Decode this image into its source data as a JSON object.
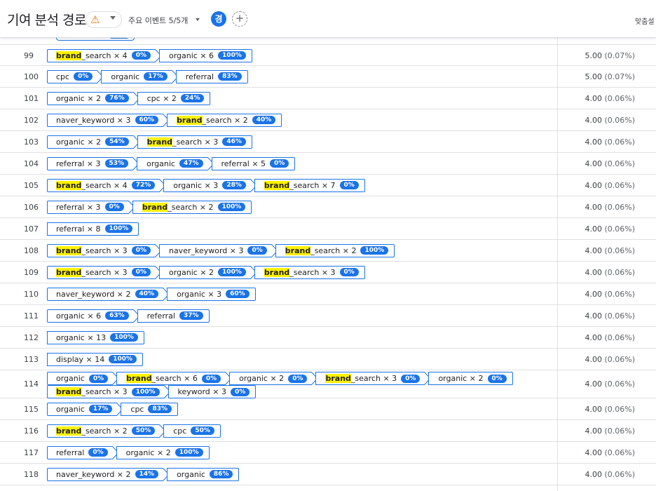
{
  "header": {
    "title": "기여 분석 경로",
    "events_label": "주요 이벤트 5/5개",
    "avatar_letter": "경",
    "add_label": "+",
    "right_text": "맞춤설"
  },
  "rows": [
    {
      "num": "99",
      "value": "5.00",
      "pct": "(0.07%)",
      "steps": [
        [
          {
            "t": "brand",
            "h": true
          },
          {
            "t": "_search × 4"
          }
        ],
        "0%"
      ],
      "path": [
        {
          "parts": [
            {
              "t": "brand",
              "h": true
            },
            {
              "t": "_search × 4"
            }
          ],
          "badge": "0%"
        },
        {
          "parts": [
            {
              "t": "organic × 6"
            }
          ],
          "badge": "100%"
        }
      ]
    },
    {
      "num": "100",
      "value": "5.00",
      "pct": "(0.07%)",
      "path": [
        {
          "parts": [
            {
              "t": "cpc"
            }
          ],
          "badge": "0%"
        },
        {
          "parts": [
            {
              "t": "organic"
            }
          ],
          "badge": "17%"
        },
        {
          "parts": [
            {
              "t": "referral"
            }
          ],
          "badge": "83%"
        }
      ]
    },
    {
      "num": "101",
      "value": "4.00",
      "pct": "(0.06%)",
      "path": [
        {
          "parts": [
            {
              "t": "organic × 2"
            }
          ],
          "badge": "76%"
        },
        {
          "parts": [
            {
              "t": "cpc × 2"
            }
          ],
          "badge": "24%"
        }
      ]
    },
    {
      "num": "102",
      "value": "4.00",
      "pct": "(0.06%)",
      "path": [
        {
          "parts": [
            {
              "t": "naver_keyword × 3"
            }
          ],
          "badge": "60%"
        },
        {
          "parts": [
            {
              "t": "brand",
              "h": true
            },
            {
              "t": "_search × 2"
            }
          ],
          "badge": "40%"
        }
      ]
    },
    {
      "num": "103",
      "value": "4.00",
      "pct": "(0.06%)",
      "path": [
        {
          "parts": [
            {
              "t": "organic × 2"
            }
          ],
          "badge": "54%"
        },
        {
          "parts": [
            {
              "t": "brand",
              "h": true
            },
            {
              "t": "_search × 3"
            }
          ],
          "badge": "46%"
        }
      ]
    },
    {
      "num": "104",
      "value": "4.00",
      "pct": "(0.06%)",
      "path": [
        {
          "parts": [
            {
              "t": "referral × 3"
            }
          ],
          "badge": "53%"
        },
        {
          "parts": [
            {
              "t": "organic"
            }
          ],
          "badge": "47%"
        },
        {
          "parts": [
            {
              "t": "referral × 5"
            }
          ],
          "badge": "0%"
        }
      ]
    },
    {
      "num": "105",
      "value": "4.00",
      "pct": "(0.06%)",
      "path": [
        {
          "parts": [
            {
              "t": "brand",
              "h": true
            },
            {
              "t": "_search × 4"
            }
          ],
          "badge": "72%"
        },
        {
          "parts": [
            {
              "t": "organic × 3"
            }
          ],
          "badge": "28%"
        },
        {
          "parts": [
            {
              "t": "brand",
              "h": true
            },
            {
              "t": "_search × 7"
            }
          ],
          "badge": "0%"
        }
      ]
    },
    {
      "num": "106",
      "value": "4.00",
      "pct": "(0.06%)",
      "path": [
        {
          "parts": [
            {
              "t": "referral × 3"
            }
          ],
          "badge": "0%"
        },
        {
          "parts": [
            {
              "t": "brand",
              "h": true
            },
            {
              "t": "_search × 2"
            }
          ],
          "badge": "100%"
        }
      ]
    },
    {
      "num": "107",
      "value": "4.00",
      "pct": "(0.06%)",
      "path": [
        {
          "parts": [
            {
              "t": "referral × 8"
            }
          ],
          "badge": "100%"
        }
      ]
    },
    {
      "num": "108",
      "value": "4.00",
      "pct": "(0.06%)",
      "path": [
        {
          "parts": [
            {
              "t": "brand",
              "h": true
            },
            {
              "t": "_search × 3"
            }
          ],
          "badge": "0%"
        },
        {
          "parts": [
            {
              "t": "naver_keyword × 3"
            }
          ],
          "badge": "0%"
        },
        {
          "parts": [
            {
              "t": "brand",
              "h": true
            },
            {
              "t": "_search × 2"
            }
          ],
          "badge": "100%"
        }
      ]
    },
    {
      "num": "109",
      "value": "4.00",
      "pct": "(0.06%)",
      "path": [
        {
          "parts": [
            {
              "t": "brand",
              "h": true
            },
            {
              "t": "_search × 3"
            }
          ],
          "badge": "0%"
        },
        {
          "parts": [
            {
              "t": "organic × 2"
            }
          ],
          "badge": "100%"
        },
        {
          "parts": [
            {
              "t": "brand",
              "h": true
            },
            {
              "t": "_search × 3"
            }
          ],
          "badge": "0%"
        }
      ]
    },
    {
      "num": "110",
      "value": "4.00",
      "pct": "(0.06%)",
      "path": [
        {
          "parts": [
            {
              "t": "naver_keyword × 2"
            }
          ],
          "badge": "40%"
        },
        {
          "parts": [
            {
              "t": "organic × 3"
            }
          ],
          "badge": "60%"
        }
      ]
    },
    {
      "num": "111",
      "value": "4.00",
      "pct": "(0.06%)",
      "path": [
        {
          "parts": [
            {
              "t": "organic × 6"
            }
          ],
          "badge": "63%"
        },
        {
          "parts": [
            {
              "t": "referral"
            }
          ],
          "badge": "37%"
        }
      ]
    },
    {
      "num": "112",
      "value": "4.00",
      "pct": "(0.06%)",
      "path": [
        {
          "parts": [
            {
              "t": "organic × 13"
            }
          ],
          "badge": "100%"
        }
      ]
    },
    {
      "num": "113",
      "value": "4.00",
      "pct": "(0.06%)",
      "path": [
        {
          "parts": [
            {
              "t": "display × 14"
            }
          ],
          "badge": "100%"
        }
      ]
    },
    {
      "num": "114",
      "value": "4.00",
      "pct": "(0.06%)",
      "path": [
        {
          "parts": [
            {
              "t": "organic"
            }
          ],
          "badge": "0%"
        },
        {
          "parts": [
            {
              "t": "brand",
              "h": true
            },
            {
              "t": "_search × 6"
            }
          ],
          "badge": "0%"
        },
        {
          "parts": [
            {
              "t": "organic × 2"
            }
          ],
          "badge": "0%"
        },
        {
          "parts": [
            {
              "t": "brand",
              "h": true
            },
            {
              "t": "_search × 3"
            }
          ],
          "badge": "0%"
        },
        {
          "parts": [
            {
              "t": "organic × 2"
            }
          ],
          "badge": "0%"
        }
      ],
      "path2": [
        {
          "parts": [
            {
              "t": "brand",
              "h": true
            },
            {
              "t": "_search × 3"
            }
          ],
          "badge": "100%"
        },
        {
          "parts": [
            {
              "t": "keyword × 3"
            }
          ],
          "badge": "0%"
        }
      ]
    },
    {
      "num": "115",
      "value": "4.00",
      "pct": "(0.06%)",
      "path": [
        {
          "parts": [
            {
              "t": "organic"
            }
          ],
          "badge": "17%"
        },
        {
          "parts": [
            {
              "t": "cpc"
            }
          ],
          "badge": "83%"
        }
      ]
    },
    {
      "num": "116",
      "value": "4.00",
      "pct": "(0.06%)",
      "path": [
        {
          "parts": [
            {
              "t": "brand",
              "h": true
            },
            {
              "t": "_search × 2"
            }
          ],
          "badge": "50%"
        },
        {
          "parts": [
            {
              "t": "cpc"
            }
          ],
          "badge": "50%"
        }
      ]
    },
    {
      "num": "117",
      "value": "4.00",
      "pct": "(0.06%)",
      "path": [
        {
          "parts": [
            {
              "t": "referral"
            }
          ],
          "badge": "0%"
        },
        {
          "parts": [
            {
              "t": "organic × 2"
            }
          ],
          "badge": "100%"
        }
      ]
    },
    {
      "num": "118",
      "value": "4.00",
      "pct": "(0.06%)",
      "path": [
        {
          "parts": [
            {
              "t": "naver_keyword × 2"
            }
          ],
          "badge": "14%"
        },
        {
          "parts": [
            {
              "t": "organic"
            }
          ],
          "badge": "86%"
        }
      ]
    }
  ],
  "colors": {
    "accent": "#1a73e8",
    "highlight": "#fff200",
    "warning": "#e8710a"
  },
  "icons": {
    "warning": "warning-icon",
    "add": "add-icon",
    "dropdown": "chevron-down-icon"
  }
}
